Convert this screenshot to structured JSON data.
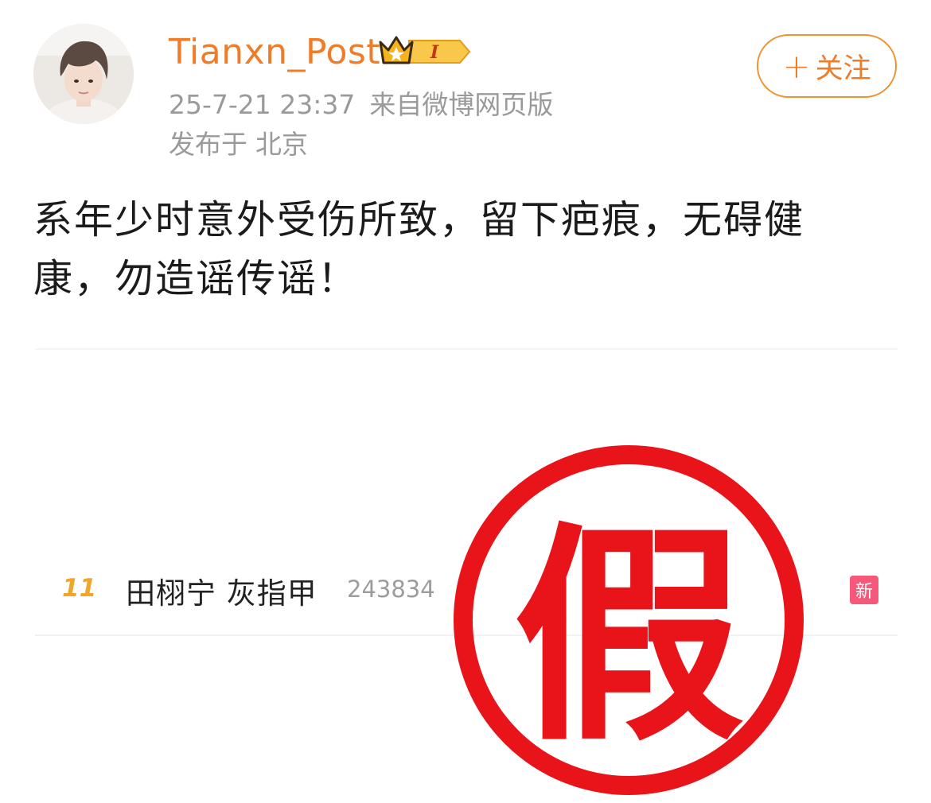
{
  "post": {
    "username": "Tianxn_Post",
    "badge_text": "I",
    "date": "25-7-21 23:37",
    "source": "来自微博网页版",
    "location_prefix": "发布于",
    "location_city": "北京",
    "follow_label": "关注",
    "text": "系年少时意外受伤所致，留下疤痕，无碍健康，勿造谣传谣！"
  },
  "trend": {
    "rank": "11",
    "title": "田栩宁 灰指甲",
    "count": "243834",
    "tag": "新"
  },
  "stamp": {
    "text": "假",
    "color": "#e8141a"
  },
  "colors": {
    "accent": "#ef7c28",
    "meta": "#9a9a9a",
    "new_tag": "#f5587b"
  }
}
